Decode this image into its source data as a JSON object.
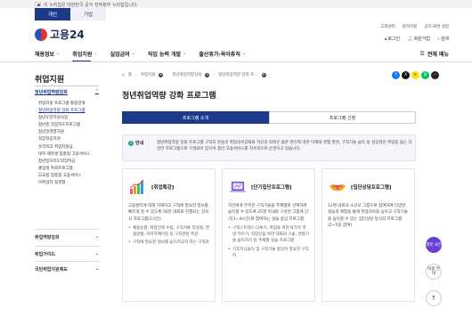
{
  "gov_bar": {
    "text": "이 누리집은 대한민국 공식 전자정부 누리집입니다."
  },
  "user_tabs": [
    {
      "label": "개인"
    },
    {
      "label": "기업"
    }
  ],
  "util_links": [
    "고객센터",
    "원격지원",
    "글자·화면 설정"
  ],
  "logo": {
    "text": "고용24"
  },
  "header_actions": [
    "로그인",
    "회원가입",
    "검색"
  ],
  "gnb": {
    "items": [
      {
        "label": "채용정보"
      },
      {
        "label": "취업지원"
      },
      {
        "label": "실업급여"
      },
      {
        "label": "직업 능력 개발"
      },
      {
        "label": "출산휴가·육아휴직"
      }
    ],
    "all_menu": "전체 메뉴"
  },
  "lnb": {
    "title": "취업지원",
    "head": "청년취업역량강화",
    "sub": [
      "취업지원 프로그램 통합검색",
      "청년취업역량 강화 프로그램",
      "청년도전지원사업",
      "청년층 직업지도프로그램",
      "청년일경험지원",
      "직장적응지원",
      "유리저고 취업지원금",
      "대학 재학생 맞춤형 고용서비스",
      "청년일자리도약장려금",
      "졸업생 특화프로그램",
      "고교생 맞춤형 고용서비스",
      "미취업자 일경험"
    ],
    "groups": [
      "취업역량강화",
      "취업가이드",
      "국민취업지원제도"
    ]
  },
  "breadcrumb": [
    "홈",
    "취업지원",
    "청년취업역량강화",
    "청년취업역량 강화 프..."
  ],
  "share_icons": [
    "f",
    "X",
    "k",
    "B",
    "⋯"
  ],
  "page_title": "청년취업역량 강화 프로그램",
  "content_tabs": [
    {
      "label": "프로그램 소개"
    },
    {
      "label": "프로그램 신청"
    }
  ],
  "info": {
    "badge": "안내",
    "body": "청년취업역량 강화 프로그램 구직자 분들의 취업의욕강화와 자신감 회복은 물론 본인에 대한 이해와 경험 발견, 구직기술 습득 등 성공적인 취업을 돕는 다양한 프로그램으로 구성되어 있으며 청년 고용서비스를 지속적으로 운영하고 있습니다."
  },
  "cards": [
    {
      "title": "[취업특강]",
      "icon": "chart-icon",
      "desc": "고용센터에 대해 이해하고 구직에 필요한 정보를 빠르게 알 수 있도록 50분 내외로 진행되는 강의식 프로그램(2시간)",
      "list": [
        "채용동향, 취업전략 수립, 구직서류 작성법, 면접방법, 이미지메이킹 등 구직관련 특강",
        "구직에 필요한 정보를 습득하고자 하는 구직자"
      ]
    },
    {
      "title": "[단기집단프로그램]",
      "icon": "laptop-icon",
      "desc": "자신에게 부족한 구직기술을 주제별로 선택하여 습득할 수 있도록 25명 이내로 구성된 그룹에 단기(1~4시간)로 참여하는 실습 중심 프로그램",
      "list": [
        "구직스트레스 다루기, 취업을 위한 N가지 역량 키우기, 직장인을 위한 대화의 기술, 면접기술 습득하기 등 주제별 실습 프로그램",
        "기초지식습득 및 구직기술 향상이 필요한 구직자"
      ]
    },
    {
      "title": "[집단상담프로그램]",
      "icon": "handshake-icon",
      "desc": "12명 내외의 소규모 그룹으로 참여하여 다양한 실습과 체험을 통해 취업의욕을 높이고 구직기술을 습득할 수 있는 집단상담 방식의 프로그램 (2~5일 참여)",
      "list": []
    }
  ],
  "fabs": [
    "챗봇 사전",
    "이용 안내",
    "↑"
  ],
  "colors": {
    "primary": "#1c3a8a",
    "accent": "#6b3fd3"
  }
}
